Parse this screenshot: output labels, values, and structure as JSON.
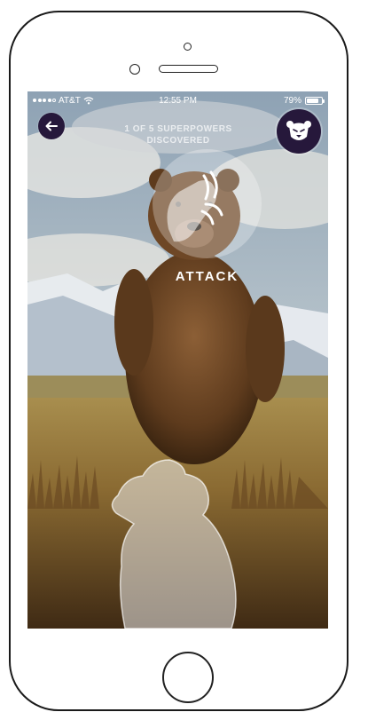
{
  "statusbar": {
    "carrier": "AT&T",
    "time": "12:55 PM",
    "battery": "79%",
    "battery_level": 0.79
  },
  "header": {
    "progress_line1": "1 OF 5 SUPERPOWERS",
    "progress_line2": "DISCOVERED",
    "back_icon": "arrow-left-icon",
    "profile_icon": "bear-face-icon"
  },
  "superpower": {
    "label": "ATTACK",
    "icon": "bear-paw-claw-icon"
  },
  "colors": {
    "badge_bg": "#26183b",
    "label_text": "#ffffff"
  }
}
